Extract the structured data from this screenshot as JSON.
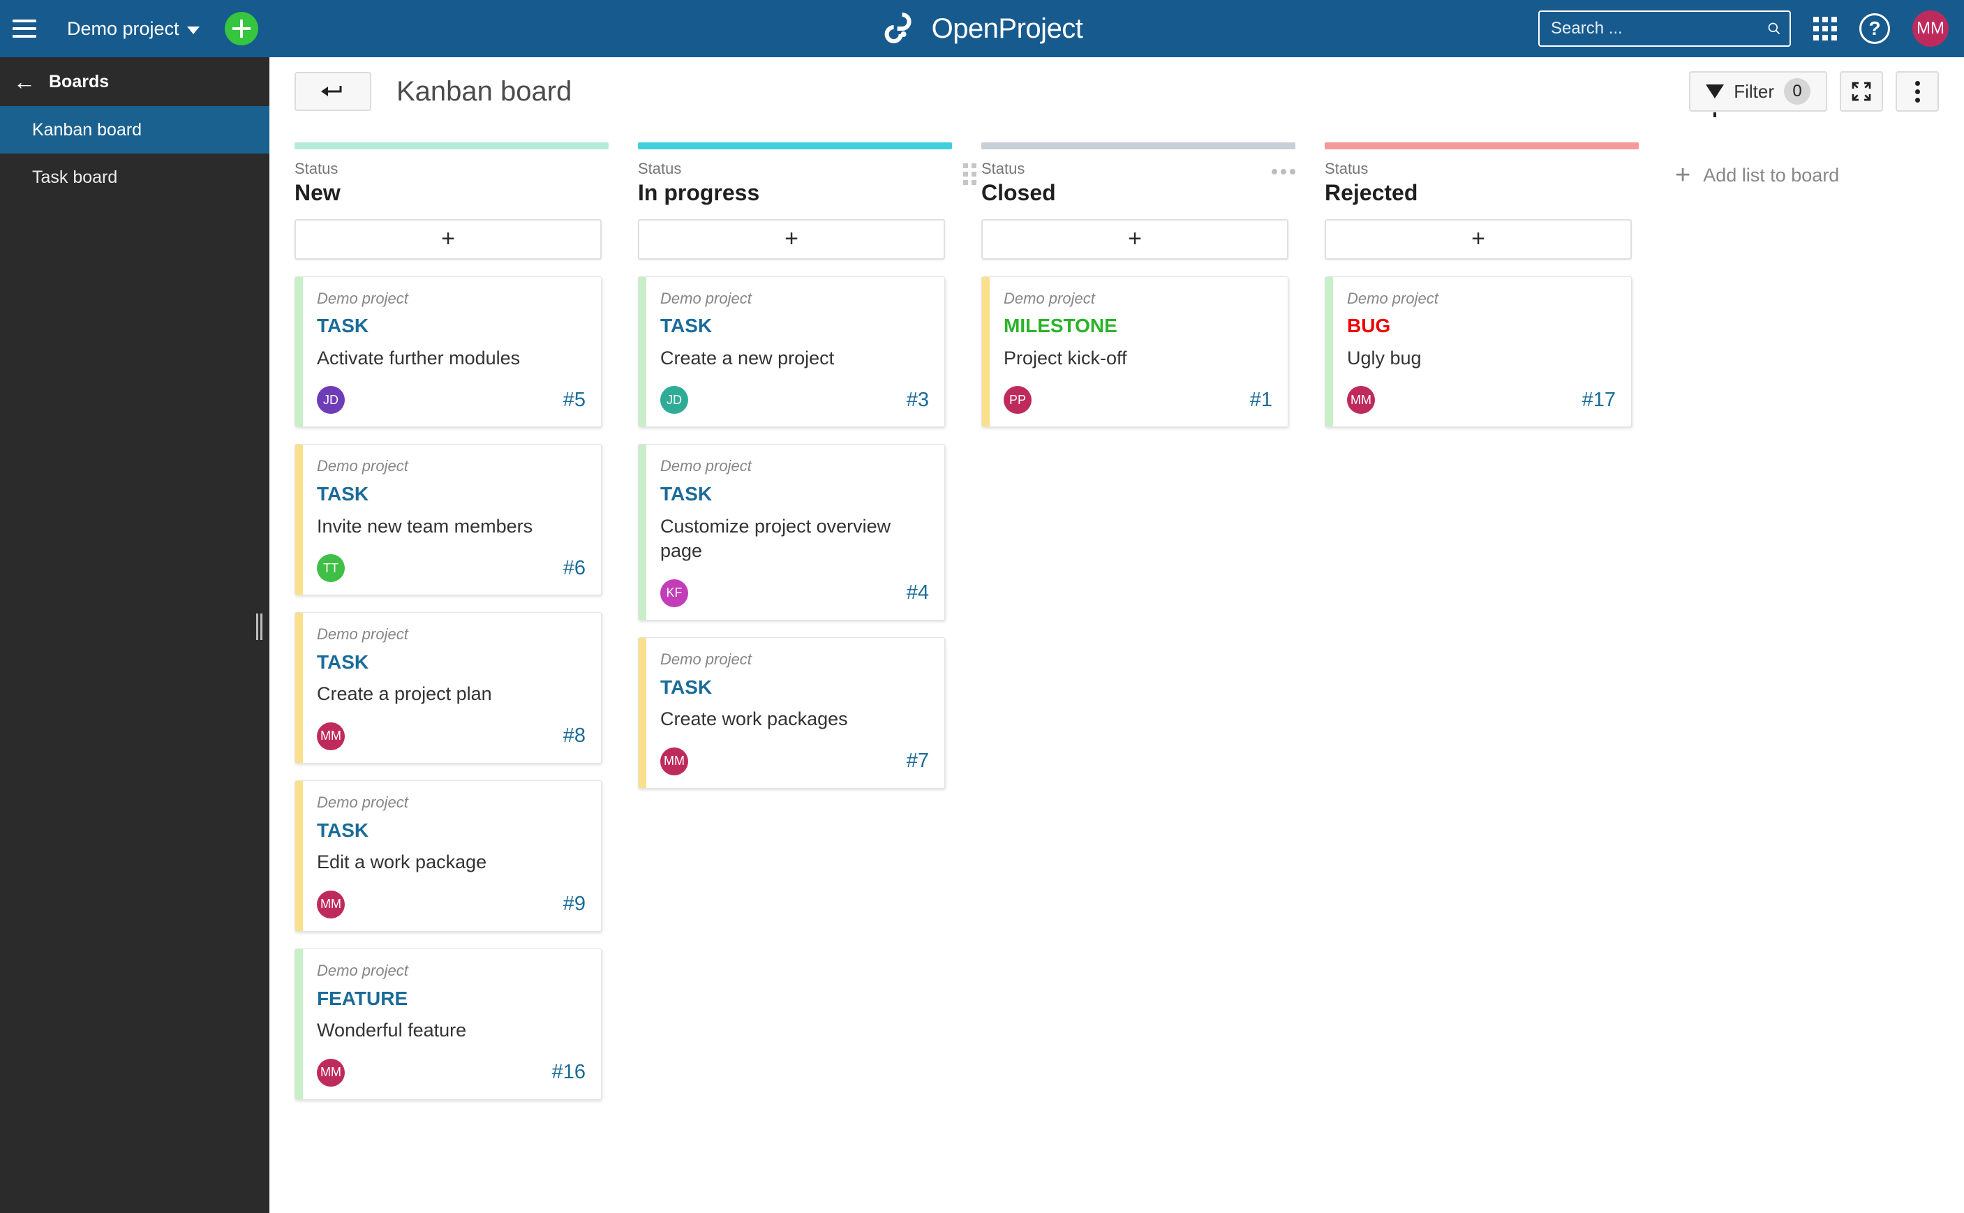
{
  "header": {
    "menu_icon": "hamburger-icon",
    "project_name": "Demo project",
    "add_icon": "plus-icon",
    "brand": "OpenProject",
    "search_placeholder": "Search ...",
    "search_value": "",
    "search_icon": "search-icon",
    "modules_icon": "grid-icon",
    "help_icon": "question-mark-icon",
    "avatar_initials": "MM",
    "avatar_color": "#bf2a5c",
    "bg_color": "#175a8e"
  },
  "sidebar": {
    "back_icon": "back-arrow-icon",
    "title": "Boards",
    "items": [
      {
        "label": "Kanban board",
        "active": true
      },
      {
        "label": "Task board",
        "active": false
      }
    ],
    "bg_color": "#2b2b2b",
    "active_color": "#1a618f"
  },
  "toolbar": {
    "back_button_icon": "back-arrow-icon",
    "page_title": "Kanban board",
    "filter_label": "Filter",
    "filter_count": "0",
    "fullscreen_icon": "fullscreen-icon",
    "more_icon": "more-vertical-icon"
  },
  "board": {
    "add_list_label": "Add list to board",
    "add_list_icon": "plus-icon",
    "add_card_icon": "plus-icon",
    "status_label": "Status",
    "columns": [
      {
        "name": "New",
        "top_color": "#b4ecd9",
        "has_drag_handle": false,
        "has_menu": false,
        "cards": [
          {
            "project": "Demo project",
            "type": "TASK",
            "type_color": "#1a6b99",
            "subject": "Activate further modules",
            "avatar": "JD",
            "avatar_color": "#6f3cb8",
            "id": "#5",
            "stripe": "#c8efc8"
          },
          {
            "project": "Demo project",
            "type": "TASK",
            "type_color": "#1a6b99",
            "subject": "Invite new team members",
            "avatar": "TT",
            "avatar_color": "#3fbf46",
            "id": "#6",
            "stripe": "#fae08a"
          },
          {
            "project": "Demo project",
            "type": "TASK",
            "type_color": "#1a6b99",
            "subject": "Create a project plan",
            "avatar": "MM",
            "avatar_color": "#bf2a5c",
            "id": "#8",
            "stripe": "#fae08a"
          },
          {
            "project": "Demo project",
            "type": "TASK",
            "type_color": "#1a6b99",
            "subject": "Edit a work package",
            "avatar": "MM",
            "avatar_color": "#bf2a5c",
            "id": "#9",
            "stripe": "#fae08a"
          },
          {
            "project": "Demo project",
            "type": "FEATURE",
            "type_color": "#1a6b99",
            "subject": "Wonderful feature",
            "avatar": "MM",
            "avatar_color": "#bf2a5c",
            "id": "#16",
            "stripe": "#c8efc8"
          }
        ]
      },
      {
        "name": "In progress",
        "top_color": "#42cfdd",
        "has_drag_handle": false,
        "has_menu": false,
        "cards": [
          {
            "project": "Demo project",
            "type": "TASK",
            "type_color": "#1a6b99",
            "subject": "Create a new project",
            "avatar": "JD",
            "avatar_color": "#2eac96",
            "id": "#3",
            "stripe": "#c8efc8"
          },
          {
            "project": "Demo project",
            "type": "TASK",
            "type_color": "#1a6b99",
            "subject": "Customize project overview page",
            "avatar": "KF",
            "avatar_color": "#c33cb8",
            "id": "#4",
            "stripe": "#c8efc8"
          },
          {
            "project": "Demo project",
            "type": "TASK",
            "type_color": "#1a6b99",
            "subject": "Create work packages",
            "avatar": "MM",
            "avatar_color": "#bf2a5c",
            "id": "#7",
            "stripe": "#fae08a"
          }
        ]
      },
      {
        "name": "Closed",
        "top_color": "#c7ced6",
        "has_drag_handle": true,
        "has_menu": true,
        "cards": [
          {
            "project": "Demo project",
            "type": "MILESTONE",
            "type_color": "#29b329",
            "subject": "Project kick-off",
            "avatar": "PP",
            "avatar_color": "#bf2a5c",
            "id": "#1",
            "stripe": "#fae08a"
          }
        ]
      },
      {
        "name": "Rejected",
        "top_color": "#f5999b",
        "has_drag_handle": false,
        "has_menu": false,
        "cards": [
          {
            "project": "Demo project",
            "type": "BUG",
            "type_color": "#f00000",
            "subject": "Ugly bug",
            "avatar": "MM",
            "avatar_color": "#bf2a5c",
            "id": "#17",
            "stripe": "#c8efc8"
          }
        ]
      }
    ]
  }
}
